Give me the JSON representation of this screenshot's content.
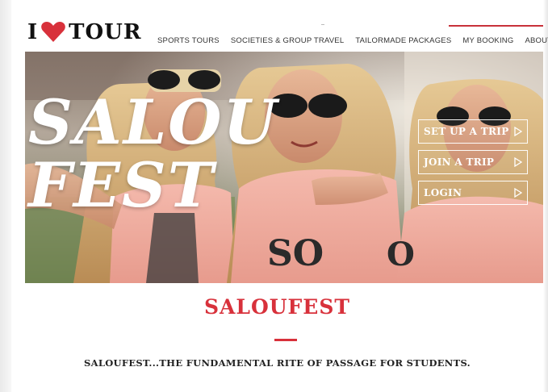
{
  "header": {
    "logo_text": "TOUR",
    "logo_prefix": "I",
    "nav": [
      {
        "label": "SPORTS TOURS"
      },
      {
        "label": "SOCIETIES & GROUP TRAVEL"
      },
      {
        "label": "TAILORMADE PACKAGES"
      },
      {
        "label": "MY BOOKING"
      },
      {
        "label": "ABOUT US"
      }
    ]
  },
  "hero": {
    "title_line1": "SALOU",
    "title_line2": "FEST",
    "buttons": [
      {
        "label": "SET UP A TRIP"
      },
      {
        "label": "JOIN A TRIP"
      },
      {
        "label": "LOGIN"
      }
    ]
  },
  "content": {
    "title": "SALOUFEST",
    "tagline": "SALOUFEST...THE FUNDAMENTAL RITE OF PASSAGE FOR STUDENTS."
  },
  "colors": {
    "accent": "#d8313b",
    "heart": "#d8313b"
  }
}
